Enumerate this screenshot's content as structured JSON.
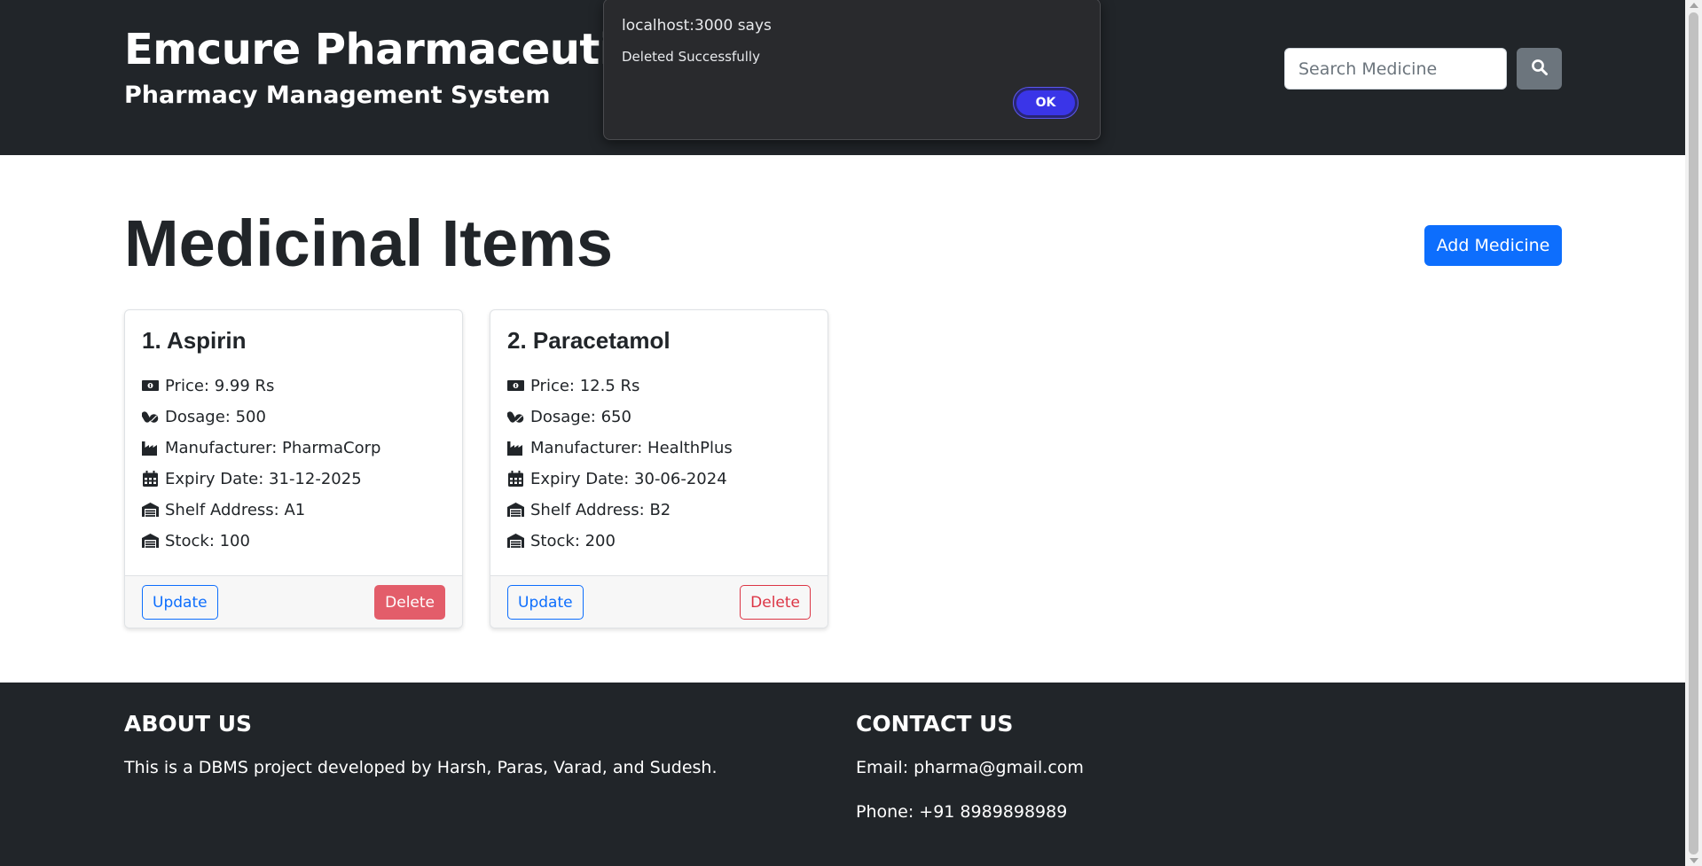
{
  "header": {
    "brand_title": "Emcure Pharmaceuticals",
    "brand_subtitle": "Pharmacy Management System",
    "search_placeholder": "Search Medicine",
    "search_icon": "search-icon"
  },
  "main": {
    "title": "Medicinal Items",
    "add_button": "Add Medicine",
    "cards": [
      {
        "title": "1. Aspirin",
        "price": "Price: 9.99 Rs",
        "dosage": "Dosage: 500",
        "manufacturer": "Manufacturer: PharmaCorp",
        "expiry": "Expiry Date: 31-12-2025",
        "shelf": "Shelf Address: A1",
        "stock": "Stock: 100",
        "update_label": "Update",
        "delete_label": "Delete"
      },
      {
        "title": "2. Paracetamol",
        "price": "Price: 12.5 Rs",
        "dosage": "Dosage: 650",
        "manufacturer": "Manufacturer: HealthPlus",
        "expiry": "Expiry Date: 30-06-2024",
        "shelf": "Shelf Address: B2",
        "stock": "Stock: 200",
        "update_label": "Update",
        "delete_label": "Delete"
      }
    ]
  },
  "footer": {
    "about_heading": "ABOUT US",
    "about_text": "This is a DBMS project developed by Harsh, Paras, Varad, and Sudesh.",
    "contact_heading": "CONTACT US",
    "email": "Email: pharma@gmail.com",
    "phone": "Phone: +91 8989898989"
  },
  "alert": {
    "title": "localhost:3000 says",
    "message": "Deleted Successfully",
    "ok_label": "OK"
  },
  "colors": {
    "header_bg": "#212529",
    "primary": "#0d6efd",
    "danger": "#dc3545",
    "dialog_bg": "#292a2d",
    "dialog_button": "#3a35e8"
  }
}
